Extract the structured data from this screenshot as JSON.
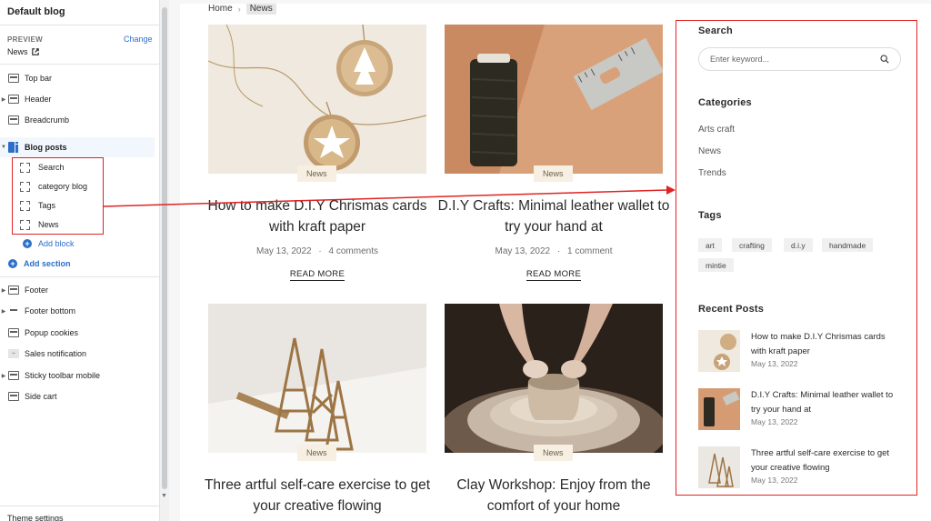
{
  "editor": {
    "title": "Default blog",
    "preview_label": "PREVIEW",
    "preview_value": "News",
    "change_label": "Change",
    "sections_top": [
      {
        "label": "Top bar"
      },
      {
        "label": "Header"
      },
      {
        "label": "Breadcrumb"
      }
    ],
    "blog_posts_label": "Blog posts",
    "blocks": [
      {
        "label": "Search"
      },
      {
        "label": "category blog"
      },
      {
        "label": "Tags"
      },
      {
        "label": "News"
      }
    ],
    "add_block_label": "Add block",
    "add_section_label": "Add section",
    "sections_bottom": [
      {
        "label": "Footer"
      },
      {
        "label": "Footer bottom"
      },
      {
        "label": "Popup cookies"
      },
      {
        "label": "Sales notification"
      },
      {
        "label": "Sticky toolbar mobile"
      },
      {
        "label": "Side cart"
      }
    ],
    "theme_settings_label": "Theme settings"
  },
  "preview": {
    "breadcrumb": {
      "home": "Home",
      "separator": "›",
      "current": "News"
    },
    "posts": [
      {
        "tag": "News",
        "title": "How to make D.I.Y Chrismas cards with kraft paper",
        "date": "May 13, 2022",
        "meta_sep": "·",
        "comments": "4 comments",
        "read_more": "READ MORE"
      },
      {
        "tag": "News",
        "title": "D.I.Y Crafts: Minimal leather wallet to try your hand at",
        "date": "May 13, 2022",
        "meta_sep": "·",
        "comments": "1 comment",
        "read_more": "READ MORE"
      },
      {
        "tag": "News",
        "title": "Three artful self-care exercise to get your creative flowing"
      },
      {
        "tag": "News",
        "title": "Clay Workshop: Enjoy from the comfort of your home"
      }
    ],
    "widgets": {
      "search_title": "Search",
      "search_placeholder": "Enter keyword...",
      "categories_title": "Categories",
      "categories": [
        "Arts craft",
        "News",
        "Trends"
      ],
      "tags_title": "Tags",
      "tags": [
        "art",
        "crafting",
        "d.i.y",
        "handmade",
        "mintie"
      ],
      "recent_title": "Recent Posts",
      "recent_posts": [
        {
          "title": "How to make D.I.Y Chrismas cards with kraft paper",
          "date": "May 13, 2022"
        },
        {
          "title": "D.I.Y Crafts: Minimal leather wallet to try your hand at",
          "date": "May 13, 2022"
        },
        {
          "title": "Three artful self-care exercise to get your creative flowing",
          "date": "May 13, 2022"
        }
      ]
    }
  },
  "colors": {
    "accent": "#2c6ecb",
    "highlight": "#e02424",
    "tag_bg": "#f7efe2"
  }
}
